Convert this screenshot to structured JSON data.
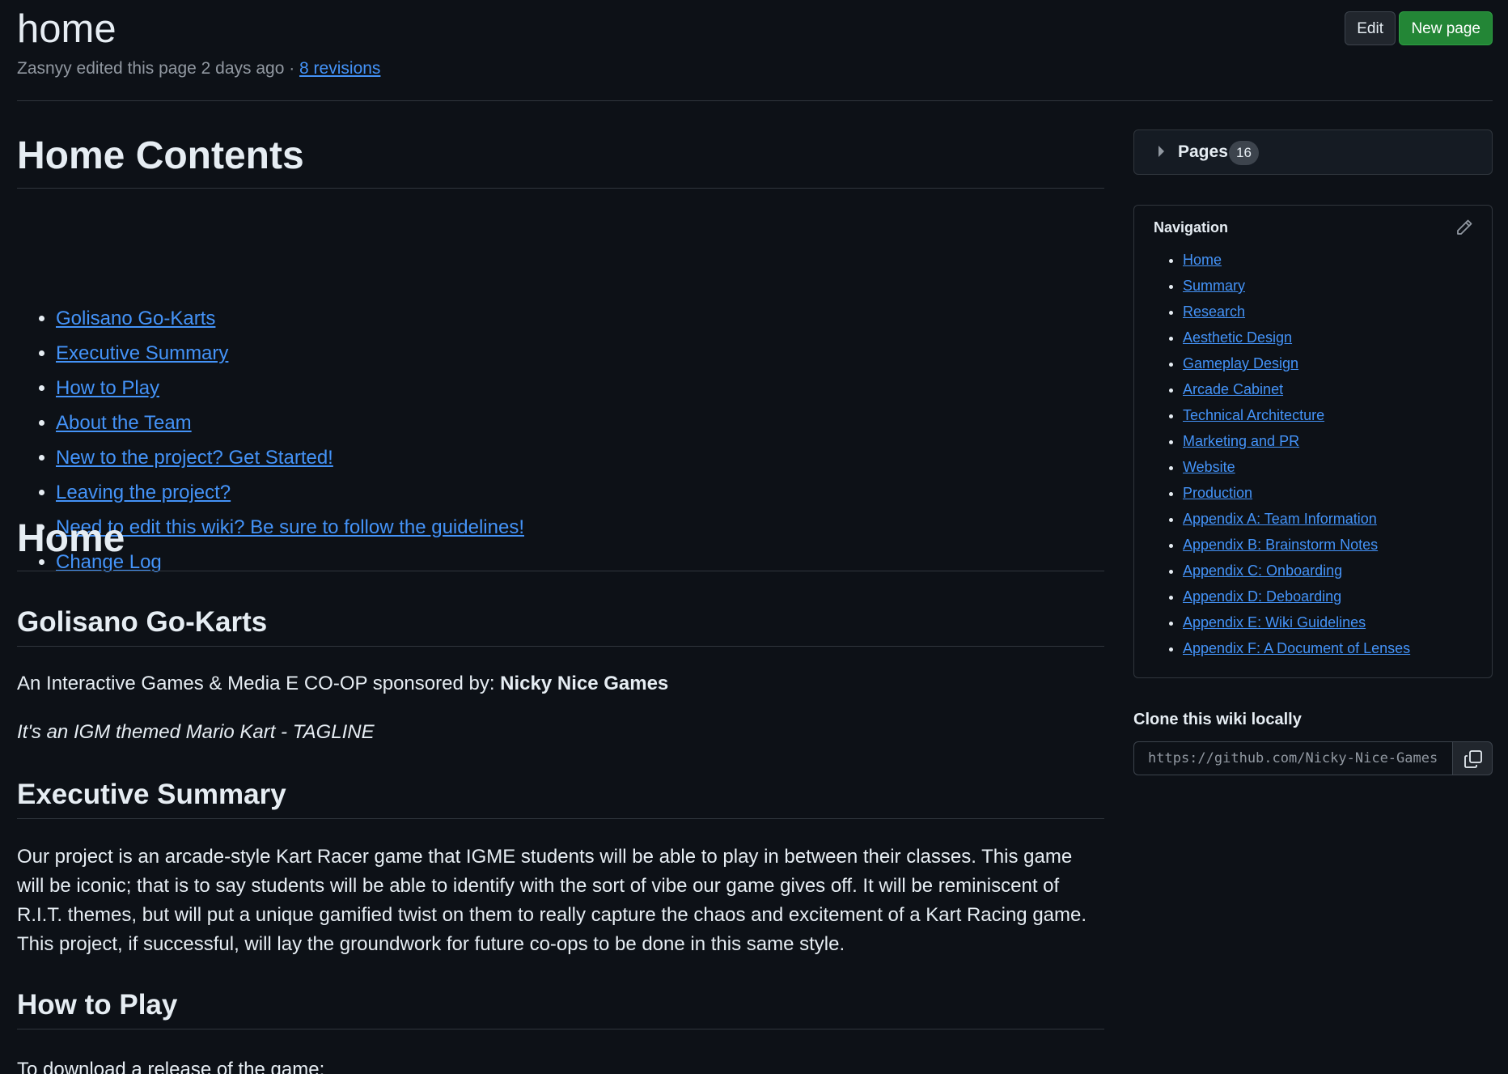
{
  "header": {
    "title": "home",
    "meta_text": "Zasnyy edited this page 2 days ago · ",
    "revisions_link": "8 revisions",
    "edit_button": "Edit",
    "new_page_button": "New page"
  },
  "main": {
    "contents_heading": "Home Contents",
    "toc": [
      "Golisano Go-Karts",
      "Executive Summary",
      "How to Play",
      "About the Team",
      "New to the project? Get Started!",
      "Leaving the project?",
      "Need to edit this wiki? Be sure to follow the guidelines!",
      "Change Log"
    ],
    "home_heading": "Home",
    "golisano_heading": "Golisano Go-Karts",
    "sponsor_text": "An Interactive Games & Media E CO-OP sponsored by: ",
    "sponsor_name": "Nicky Nice Games",
    "tagline": "It's an IGM themed Mario Kart - TAGLINE",
    "exec_heading": "Executive Summary",
    "exec_body": "Our project is an arcade-style Kart Racer game that IGME students will be able to play in between their classes. This game will be iconic; that is to say students will be able to identify with the sort of vibe our game gives off. It will be reminiscent of R.I.T. themes, but will put a unique gamified twist on them to really capture the chaos and excitement of a Kart Racing game. This project, if successful, will lay the groundwork for future co-ops to be done in this same style.",
    "howto_heading": "How to Play",
    "download_text": "To download a release of the game:"
  },
  "sidebar": {
    "pages_label": "Pages",
    "pages_count": "16",
    "nav_title": "Navigation",
    "nav_items": [
      "Home",
      "Summary",
      "Research",
      "Aesthetic Design",
      "Gameplay Design",
      "Arcade Cabinet",
      "Technical Architecture",
      "Marketing and PR",
      "Website",
      "Production",
      "Appendix A: Team Information",
      "Appendix B: Brainstorm Notes",
      "Appendix C: Onboarding",
      "Appendix D: Deboarding",
      "Appendix E: Wiki Guidelines",
      "Appendix F: A Document of Lenses"
    ],
    "clone_title": "Clone this wiki locally",
    "clone_url": "https://github.com/Nicky-Nice-Games/"
  },
  "colors": {
    "background": "#0d1117",
    "text": "#e6edf3",
    "muted": "#9198a1",
    "link": "#4493f8",
    "border": "#30363d",
    "primary_button": "#238636"
  },
  "icons": {
    "pages_toggle": "triangle-right-icon",
    "nav_edit": "pencil-icon",
    "clone_copy": "copy-icon"
  }
}
